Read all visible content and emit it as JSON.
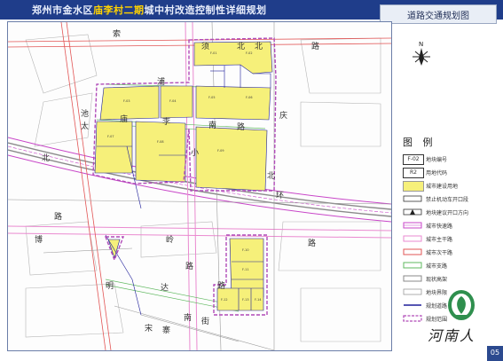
{
  "header": {
    "title_prefix": "郑州市金水区",
    "title_highlight": "庙李村二期",
    "title_suffix": "城中村改造控制性详细规划",
    "section_tab": "道路交通规划图"
  },
  "map": {
    "road_labels": {
      "suo": "索",
      "xu": "须",
      "bei": "北",
      "lu_top": "路",
      "bei2": "北",
      "pu": "浦",
      "miao": "庙",
      "li": "李",
      "nan": "南",
      "lu_mid": "路",
      "qing": "庆",
      "chi": "池",
      "tai": "太",
      "xiao": "小",
      "bei_left": "北",
      "bei_right": "北",
      "huan": "环",
      "lu_left": "路",
      "bo": "博",
      "ling": "岭",
      "lu_low": "路",
      "lu_low2": "路",
      "ming": "明",
      "da": "达",
      "lu_bottom": "路",
      "song": "宋",
      "zhai": "寨",
      "nan_low": "南",
      "jie": "街"
    },
    "plot_codes": [
      "F-01",
      "F-02",
      "F-03",
      "F-04",
      "F-05",
      "F-06",
      "F-07",
      "F-08",
      "F-09",
      "F-10",
      "F-11",
      "F-12",
      "F-13",
      "F-14"
    ],
    "plot_use": "R2",
    "colors": {
      "construction_land": "#f6f07a",
      "expressway": "#c845c8",
      "trunk_road": "#ea8ad0",
      "secondary_trunk": "#e25555",
      "branch_road": "#5fb85f",
      "support_road": "#9a9a9a",
      "boundary": "#1f1f9a",
      "planning_scope": "#b04ab8"
    }
  },
  "legend": {
    "title": "图  例",
    "items": [
      {
        "label": "地块编号",
        "sym_text": "F-02"
      },
      {
        "label": "用地代码",
        "sym_text": "R2"
      },
      {
        "label": "城市建设用地"
      },
      {
        "label": "禁止机动车开口段"
      },
      {
        "label": "地块建议开口方向"
      },
      {
        "label": "城市快速路"
      },
      {
        "label": "城市主干路"
      },
      {
        "label": "城市次干路"
      },
      {
        "label": "城市支路"
      },
      {
        "label": "现状高架"
      },
      {
        "label": "地块界限"
      },
      {
        "label": "规划道路"
      },
      {
        "label": "规划范围"
      }
    ]
  },
  "compass": {
    "label": "N"
  },
  "brand": {
    "text": "河南人"
  },
  "page": {
    "number": "05"
  }
}
